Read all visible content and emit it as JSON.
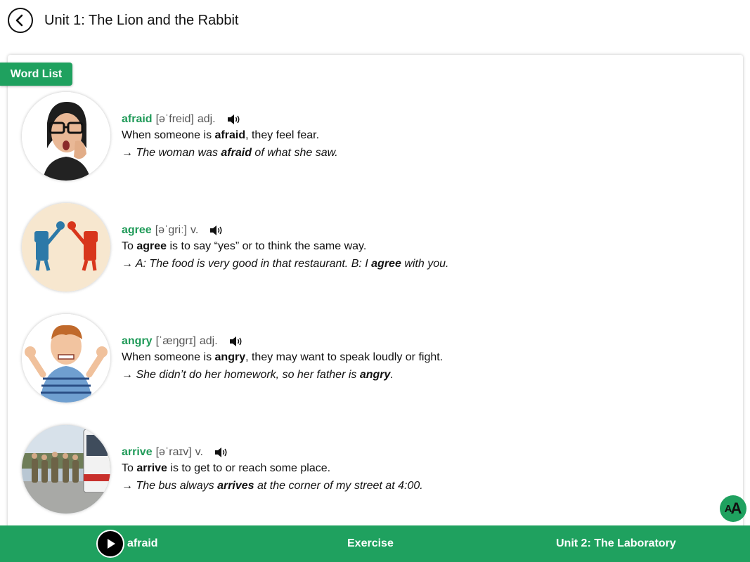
{
  "header": {
    "title": "Unit 1: The Lion and the Rabbit"
  },
  "word_list_label": "Word List",
  "entries": [
    {
      "word": "afraid",
      "pron": "[əˈfreid]",
      "pos": "adj.",
      "def_pre": "When someone is ",
      "def_word": "afraid",
      "def_post": ", they feel fear.",
      "ex_pre": "→ The woman was ",
      "ex_word": "afraid",
      "ex_post": " of what she saw."
    },
    {
      "word": "agree",
      "pron": "[əˈgriː]",
      "pos": "v.",
      "def_pre": "To ",
      "def_word": "agree",
      "def_post": " is to say “yes” or to think the same way.",
      "ex_pre": "→ A: The food is very good in that restaurant. B: I ",
      "ex_word": "agree",
      "ex_post": " with you."
    },
    {
      "word": "angry",
      "pron": "[ˈæŋgrɪ]",
      "pos": "adj.",
      "def_pre": "When someone is ",
      "def_word": "angry",
      "def_post": ", they may want to speak loudly or fight.",
      "ex_pre": "→ She didn’t do her homework, so her father is ",
      "ex_word": "angry",
      "ex_post": "."
    },
    {
      "word": "arrive",
      "pron": "[əˈraɪv]",
      "pos": "v.",
      "def_pre": "To ",
      "def_word": "arrive",
      "def_post": " is to get to or reach some place.",
      "ex_pre": "→ The bus always ",
      "ex_word": "arrives",
      "ex_post": " at the corner of my street at 4:00."
    }
  ],
  "font_button": {
    "small": "A",
    "big": "A"
  },
  "footer": {
    "current_word": "afraid",
    "exercise_label": "Exercise",
    "next_unit_label": "Unit 2: The Laboratory"
  },
  "colors": {
    "accent": "#1fa15f",
    "word": "#1f9a58"
  },
  "icons": {
    "back": "chevron-left-icon",
    "speaker": "speaker-icon",
    "play": "play-icon",
    "font": "font-size-icon"
  }
}
